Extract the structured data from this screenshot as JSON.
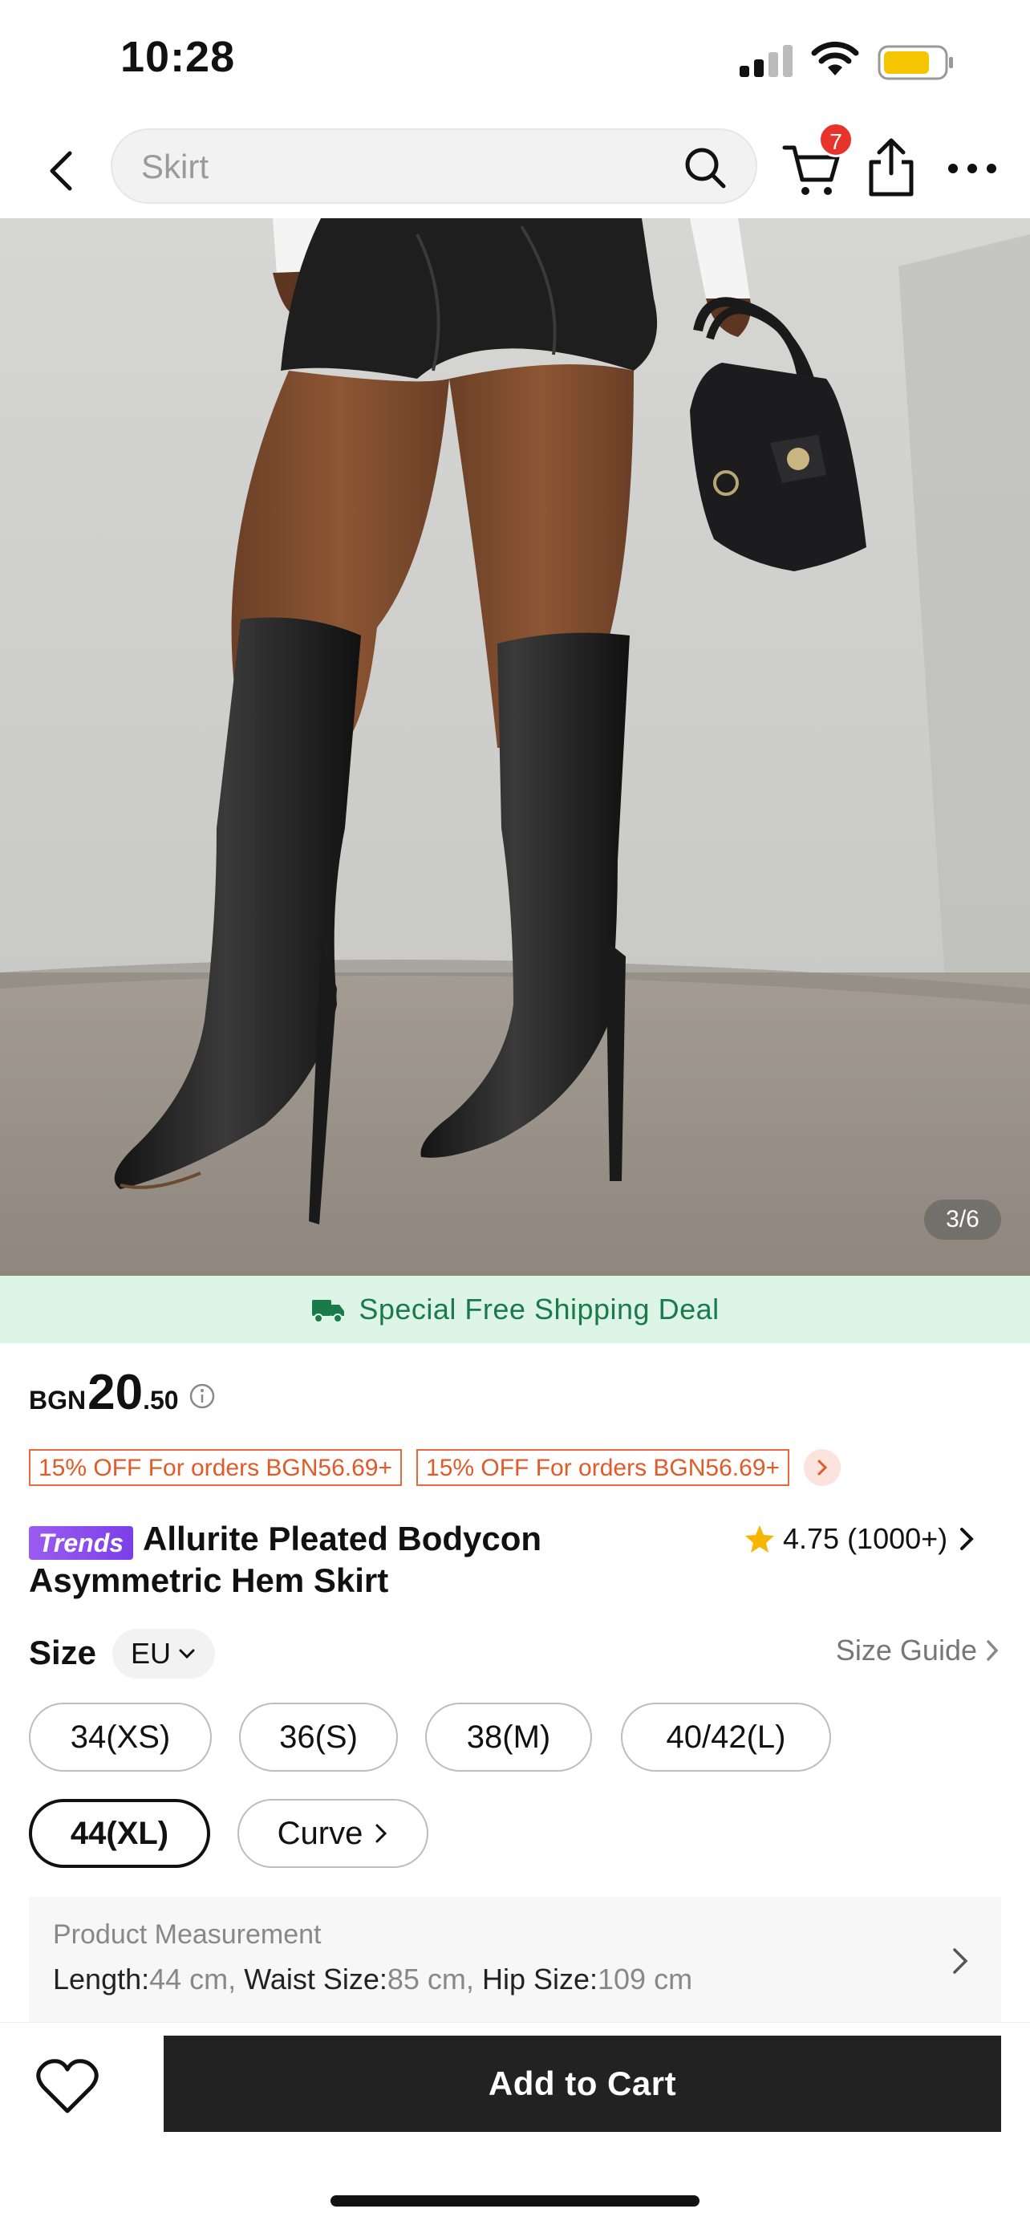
{
  "status_bar": {
    "time": "10:28"
  },
  "header": {
    "search_placeholder": "Skirt",
    "cart_count": "7"
  },
  "gallery": {
    "counter": "3/6"
  },
  "shipping": {
    "text": "Special Free Shipping Deal",
    "color": "#1b7a4a"
  },
  "price": {
    "currency": "BGN",
    "main": "20",
    "decimal": ".50"
  },
  "coupons": [
    {
      "label": "15% OFF For orders BGN56.69+"
    },
    {
      "label": "15% OFF For orders BGN56.69+"
    }
  ],
  "product": {
    "badge": "Trends",
    "title": "Allurite Pleated Bodycon Asymmetric Hem Skirt",
    "rating": "4.75 (1000+)"
  },
  "size": {
    "label": "Size",
    "unit": "EU",
    "guide_label": "Size Guide",
    "options": [
      {
        "label": "34(XS)",
        "selected": false
      },
      {
        "label": "36(S)",
        "selected": false
      },
      {
        "label": "38(M)",
        "selected": false
      },
      {
        "label": "40/42(L)",
        "selected": false
      },
      {
        "label": "44(XL)",
        "selected": true
      },
      {
        "label": "Curve",
        "selected": false
      }
    ]
  },
  "measurement": {
    "title": "Product Measurement",
    "length_label": "Length:",
    "length_value": "44 cm,",
    "waist_label": "Waist Size:",
    "waist_value": "85 cm,",
    "hip_label": "Hip Size:",
    "hip_value": "109 cm"
  },
  "actions": {
    "add_to_cart": "Add to Cart"
  },
  "colors": {
    "accent_dark": "#222222",
    "coupon": "#e25a28",
    "badge": "#e8332b",
    "trends": "#8b4cec"
  }
}
